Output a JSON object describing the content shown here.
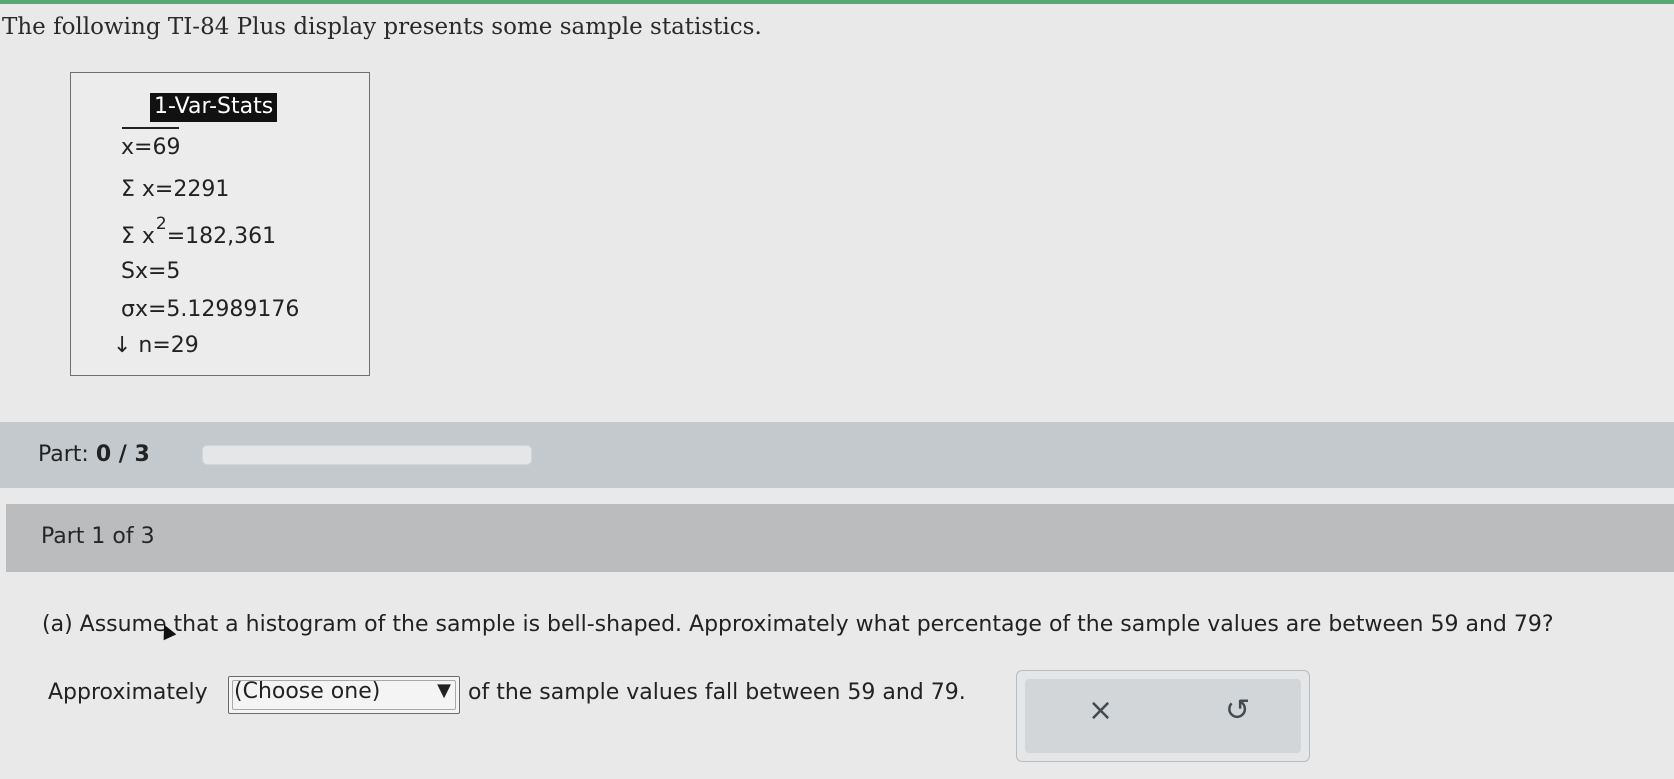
{
  "intro": {
    "text": "The following TI-84 Plus display presents some sample statistics."
  },
  "calculator": {
    "title": "1-Var-Stats",
    "lines": {
      "xbar": "x=69",
      "sum_x": "Σ x=2291",
      "sum_x2_prefix": "Σ x",
      "sum_x2_exp": "2",
      "sum_x2_value": "=182,361",
      "sx": "Sx=5",
      "sigma_x": "σx=5.12989176",
      "n": "↓ n=29"
    }
  },
  "progress": {
    "label": "Part:",
    "value": "0 / 3",
    "completed": 0,
    "total": 3,
    "accent_color": "#5f8fb8"
  },
  "section": {
    "title": "Part 1 of 3"
  },
  "question": {
    "text": "(a) Assume that a histogram of the sample is bell-shaped. Approximately what percentage of the sample values are between 59 and 79?"
  },
  "answer": {
    "prefix": "Approximately",
    "dropdown_value": "(Choose one)",
    "dropdown_arrow_icon": "triangle-down-icon",
    "suffix": "of the sample values fall between 59 and 79."
  },
  "actions": {
    "clear_icon": "×",
    "undo_icon": "↺"
  }
}
